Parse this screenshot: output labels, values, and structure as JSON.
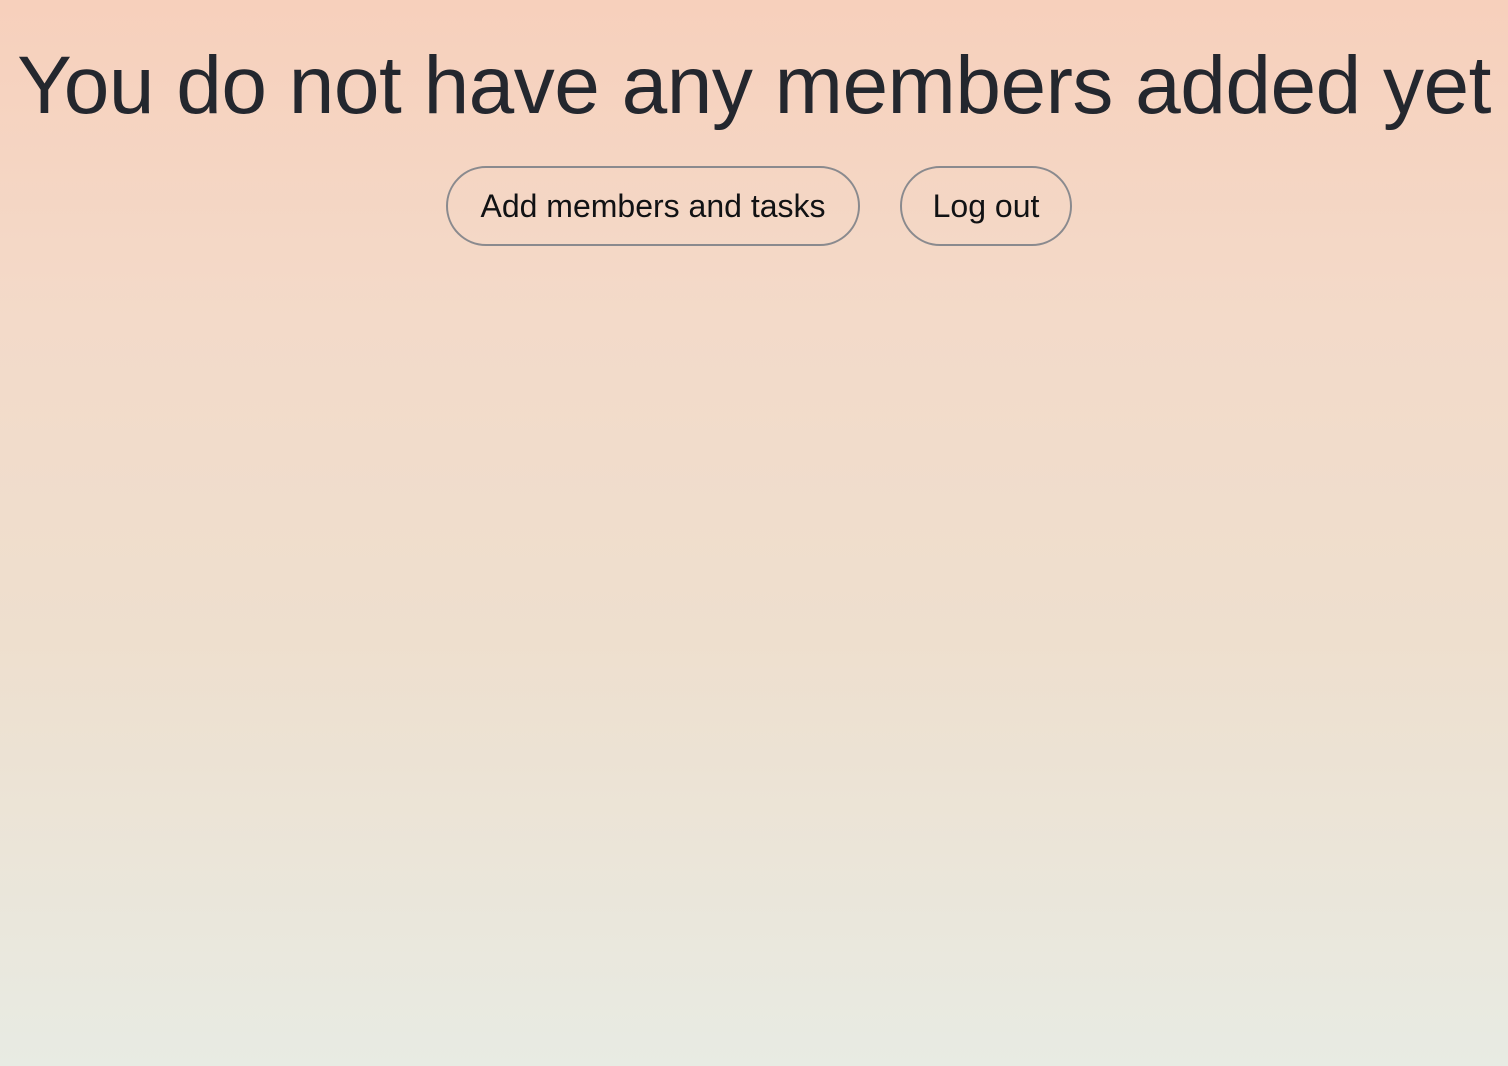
{
  "main": {
    "heading": "You do not have any members added yet",
    "actions": {
      "add_members_label": "Add members and tasks",
      "logout_label": "Log out"
    }
  },
  "colors": {
    "background_top": "#f7d0bc",
    "background_bottom": "#e8ebe3",
    "text": "#24272e",
    "button_border": "#8a8a8e"
  }
}
